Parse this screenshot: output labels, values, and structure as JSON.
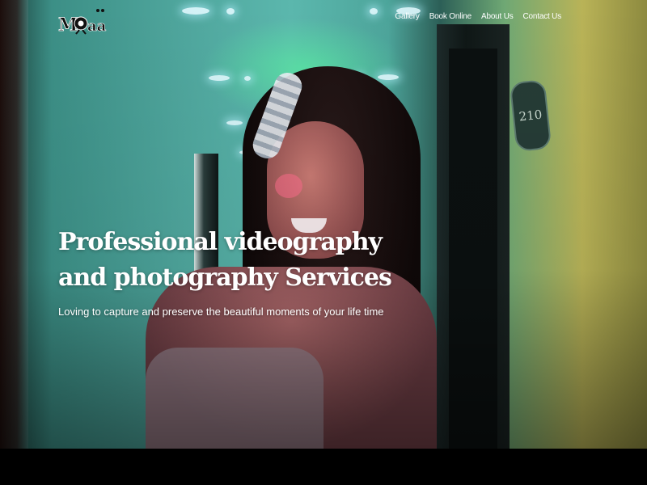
{
  "header": {
    "logo_text": "Moyaa",
    "nav": [
      "Gallery",
      "Book Online",
      "About Us",
      "Contact Us"
    ]
  },
  "hero": {
    "headline_line1": "Professional videography",
    "headline_line2": "and photography Services",
    "subtitle": "Loving to capture and preserve the beautiful moments of your life time",
    "room_number": "210"
  }
}
